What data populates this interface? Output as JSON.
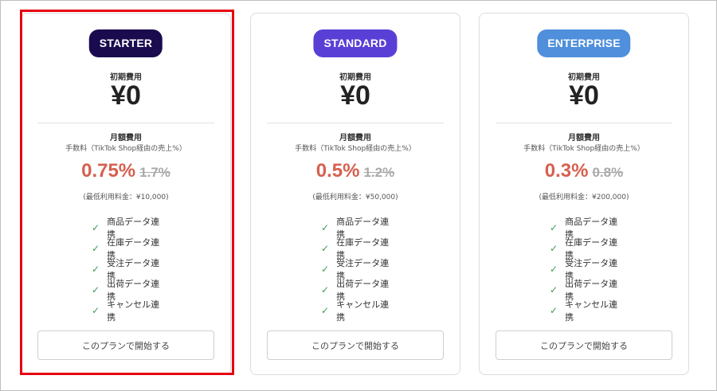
{
  "colors": {
    "starter_badge": "#1a0b4f",
    "standard_badge": "#5a3fd6",
    "enterprise_badge": "#4f8fdb",
    "rate": "#d6604f",
    "check": "#3f9b57",
    "highlight_border": "#e60012"
  },
  "icons": {
    "feature_check": "check-icon"
  },
  "plans": [
    {
      "badge": "STARTER",
      "initial_label": "初期費用",
      "initial_price": "¥0",
      "monthly_label": "月額費用",
      "fee_note": "手数料（TikTok Shop経由の売上%）",
      "rate": "0.75%",
      "old_rate": "1.7%",
      "min_fee": "(最低利用料金：¥10,000)",
      "features": [
        "商品データ連携",
        "在庫データ連携",
        "受注データ連携",
        "出荷データ連携",
        "キャンセル連携"
      ],
      "cta": "このプランで開始する"
    },
    {
      "badge": "STANDARD",
      "initial_label": "初期費用",
      "initial_price": "¥0",
      "monthly_label": "月額費用",
      "fee_note": "手数料（TikTok Shop経由の売上%）",
      "rate": "0.5%",
      "old_rate": "1.2%",
      "min_fee": "(最低利用料金：¥50,000)",
      "features": [
        "商品データ連携",
        "在庫データ連携",
        "受注データ連携",
        "出荷データ連携",
        "キャンセル連携"
      ],
      "cta": "このプランで開始する"
    },
    {
      "badge": "ENTERPRISE",
      "initial_label": "初期費用",
      "initial_price": "¥0",
      "monthly_label": "月額費用",
      "fee_note": "手数料（TikTok Shop経由の売上%）",
      "rate": "0.3%",
      "old_rate": "0.8%",
      "min_fee": "(最低利用料金：¥200,000)",
      "features": [
        "商品データ連携",
        "在庫データ連携",
        "受注データ連携",
        "出荷データ連携",
        "キャンセル連携"
      ],
      "cta": "このプランで開始する"
    }
  ]
}
